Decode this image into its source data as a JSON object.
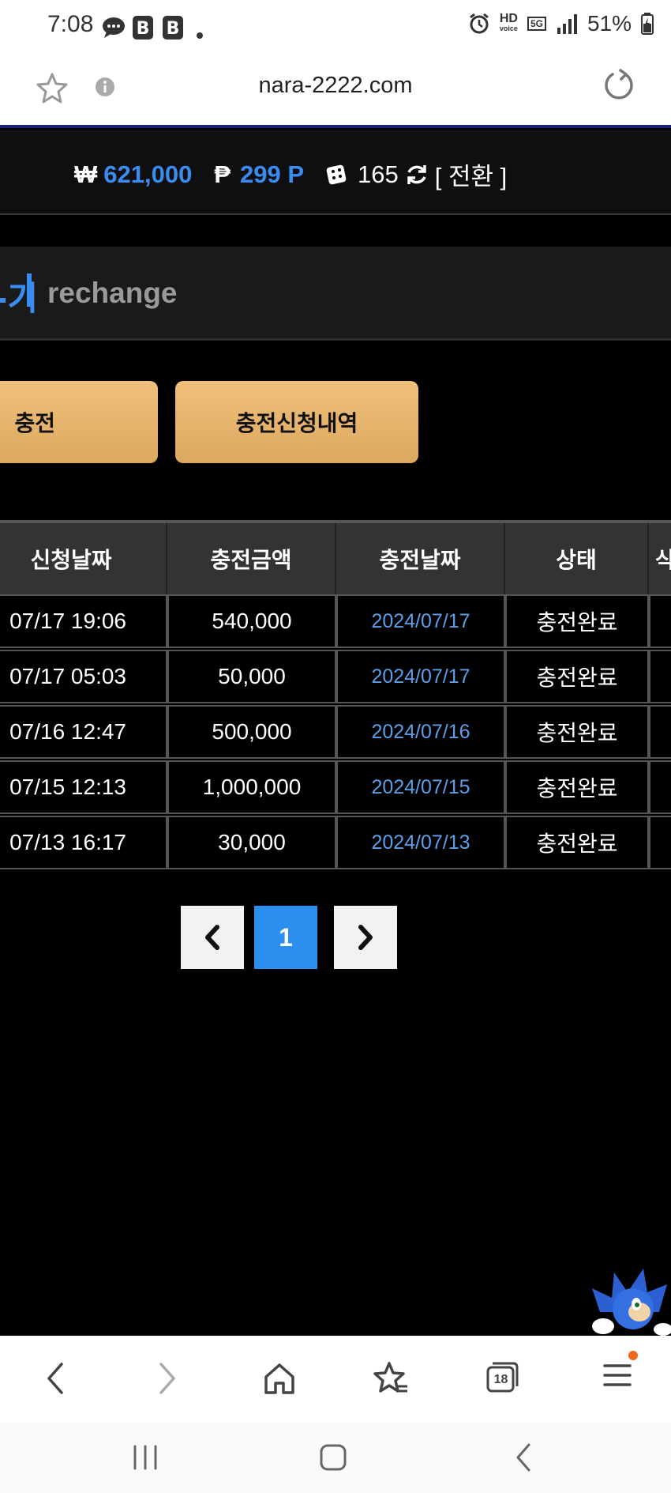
{
  "status_bar": {
    "time": "7:08",
    "network": "5G",
    "hd": "HD",
    "voice": "voice",
    "battery": "51%"
  },
  "browser": {
    "url": "nara-2222.com"
  },
  "balance": {
    "won_symbol": "₩",
    "won_amount": "621,000",
    "point_symbol": "₱",
    "points": "299 P",
    "chips": "165",
    "convert_label": "[ 전환 ]"
  },
  "page_title": {
    "korean_partial": "-기",
    "english": "rechange"
  },
  "buttons": {
    "charge": "충전",
    "charge_history": "충전신청내역"
  },
  "table": {
    "headers": [
      "신청날짜",
      "충전금액",
      "충전날짜",
      "상태",
      "삭"
    ],
    "rows": [
      {
        "request_date": "07/17 19:06",
        "amount": "540,000",
        "charge_date": "2024/07/17",
        "status": "충전완료"
      },
      {
        "request_date": "07/17 05:03",
        "amount": "50,000",
        "charge_date": "2024/07/17",
        "status": "충전완료"
      },
      {
        "request_date": "07/16 12:47",
        "amount": "500,000",
        "charge_date": "2024/07/16",
        "status": "충전완료"
      },
      {
        "request_date": "07/15 12:13",
        "amount": "1,000,000",
        "charge_date": "2024/07/15",
        "status": "충전완료"
      },
      {
        "request_date": "07/13 16:17",
        "amount": "30,000",
        "charge_date": "2024/07/13",
        "status": "충전완료"
      }
    ]
  },
  "pagination": {
    "current": "1"
  },
  "toolbar": {
    "tab_count": "18"
  },
  "colors": {
    "accent_blue": "#3a8df0",
    "gold": "#e8b56c",
    "date_blue": "#5b9fe8"
  }
}
